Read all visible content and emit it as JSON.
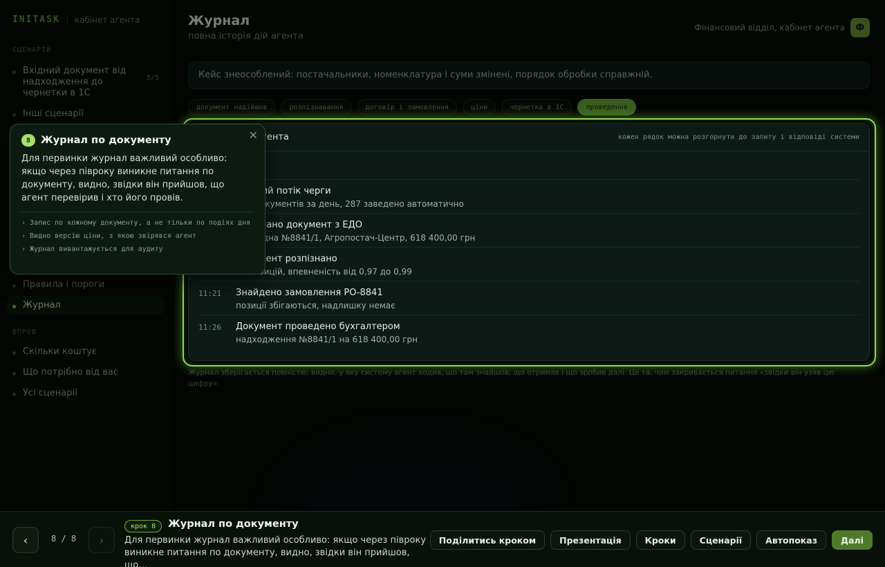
{
  "brand": {
    "logo": "INITASK",
    "subtitle": "кабінет агента"
  },
  "sidebar": {
    "section_scenario": "СЦЕНАРІЙ",
    "scenario_items": [
      {
        "label": "Вхідний документ від надходження до чернетки в 1С",
        "count": "5/5"
      },
      {
        "label": "Інші сценарії"
      }
    ],
    "agent_items": [
      {
        "label": "Правила і пороги"
      },
      {
        "label": "Журнал"
      }
    ],
    "section_more": "ВПРОВ",
    "more_items": [
      {
        "label": "Скільки коштує"
      },
      {
        "label": "Що потрібно від вас"
      },
      {
        "label": "Усі сценарії"
      }
    ]
  },
  "header": {
    "title": "Журнал",
    "subtitle": "повна історія дій агента",
    "org": "Фінансовий відділ, кабінет агента",
    "avatar": "Ф"
  },
  "case_banner": "Кейс знеособлений: постачальники, номенклатура і суми змінені, порядок обробки справжній.",
  "chips": [
    "документ надійшов",
    "розпізнавання",
    "договір і замовлення",
    "ціни",
    "чернетка в 1С",
    "проведення"
  ],
  "active_chip": 5,
  "journal": {
    "title": "Журнал дій агента",
    "hint": "кожен рядок можна розгорнути до запиту і відповіді системи",
    "entries": [
      {
        "time": "",
        "title": "Вхідний потік черги",
        "detail": "342 документів за день, 287 заведено автоматично"
      },
      {
        "time": "",
        "title": "Отримано документ з ЕДО",
        "detail": "Накладна №8841/1, Агропостач-Центр, 618 400,00 грн"
      },
      {
        "time": "",
        "title": "Документ розпізнано",
        "detail": "14 позицій, впевненість від 0,97 до 0,99"
      },
      {
        "time": "11:21",
        "title": "Знайдено замовлення PO-8841",
        "detail": "позиції збігаються, надлишку немає"
      },
      {
        "time": "11:26",
        "title": "Документ проведено бухгалтером",
        "detail": "надходження №8841/1 на 618 400,00 грн"
      }
    ]
  },
  "footnote": "Журнал зберігається повністю: видно, у яку систему агент ходив, що там знайшов, що отримав і що зробив далі. Це та, чим закривається питання «звідки він узяв цю цифру».",
  "popover": {
    "step": "8",
    "title": "Журнал по документу",
    "body": "Для первинки журнал важливий особливо: якщо через півроку виникне питання по документу, видно, звідки він прийшов, що агент перевірив і хто його провів.",
    "bullets": [
      "Запис по кожному документу, а не тільки по подіях дня",
      "Видно версію ціни, з якою звірявся агент",
      "Журнал вивантажується для аудиту"
    ],
    "close": "✕"
  },
  "bottom": {
    "prev": "‹",
    "next": "›",
    "pager": "8 / 8",
    "badge": "крок 8",
    "title": "Журнал по документу",
    "desc": "Для первинки журнал важливий особливо: якщо через півроку виникне питання по документу, видно, звідки він прийшов, що…",
    "actions": [
      "Поділитись кроком",
      "Презентація",
      "Кроки",
      "Сценарії",
      "Автопоказ"
    ],
    "primary": "Далі"
  },
  "colors": {
    "accent": "#8fd95a",
    "active_chip": "#6fb23a",
    "primary_button": "#4f7a2c"
  }
}
